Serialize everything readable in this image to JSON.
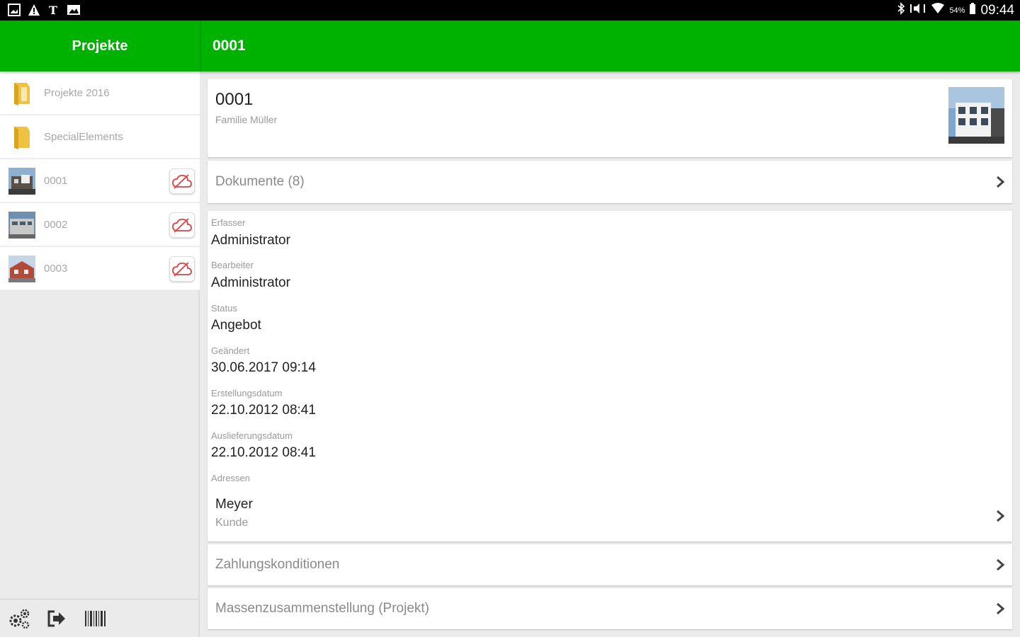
{
  "statusbar": {
    "time": "09:44",
    "battery": "54%",
    "icons_left": [
      "gallery-icon",
      "warning-icon",
      "news-icon",
      "photo-icon"
    ],
    "icons_right": [
      "bluetooth-icon",
      "mute-icon",
      "wifi-icon",
      "battery-icon"
    ]
  },
  "appbar": {
    "left_title": "Projekte",
    "title": "0001",
    "accent": "#00b200"
  },
  "sidebar": {
    "items": [
      {
        "label": "Projekte 2016",
        "icon": "folder-icon"
      },
      {
        "label": "SpecialElements",
        "icon": "folder-icon"
      },
      {
        "label": "0001",
        "icon": "building-photo",
        "cloud": "cloud-off-icon"
      },
      {
        "label": "0002",
        "icon": "building-photo",
        "cloud": "cloud-off-icon"
      },
      {
        "label": "0003",
        "icon": "building-photo",
        "cloud": "cloud-off-icon"
      }
    ],
    "footer_icons": [
      "settings-icon",
      "logout-icon",
      "barcode-icon"
    ]
  },
  "project": {
    "number": "0001",
    "subtitle": "Familie Müller"
  },
  "documents": {
    "label": "Dokumente (8)"
  },
  "details": {
    "fields": [
      {
        "label": "Erfasser",
        "value": "Administrator"
      },
      {
        "label": "Bearbeiter",
        "value": "Administrator"
      },
      {
        "label": "Status",
        "value": "Angebot"
      },
      {
        "label": "Geändert",
        "value": "30.06.2017 09:14"
      },
      {
        "label": "Erstellungsdatum",
        "value": "22.10.2012 08:41"
      },
      {
        "label": "Auslieferungsdatum",
        "value": "22.10.2012 08:41"
      }
    ],
    "addresses_label": "Adressen",
    "address": {
      "name": "Meyer",
      "role": "Kunde"
    }
  },
  "payment": {
    "label": "Zahlungskonditionen"
  },
  "quantities": {
    "label": "Massenzusammenstellung (Projekt)"
  }
}
